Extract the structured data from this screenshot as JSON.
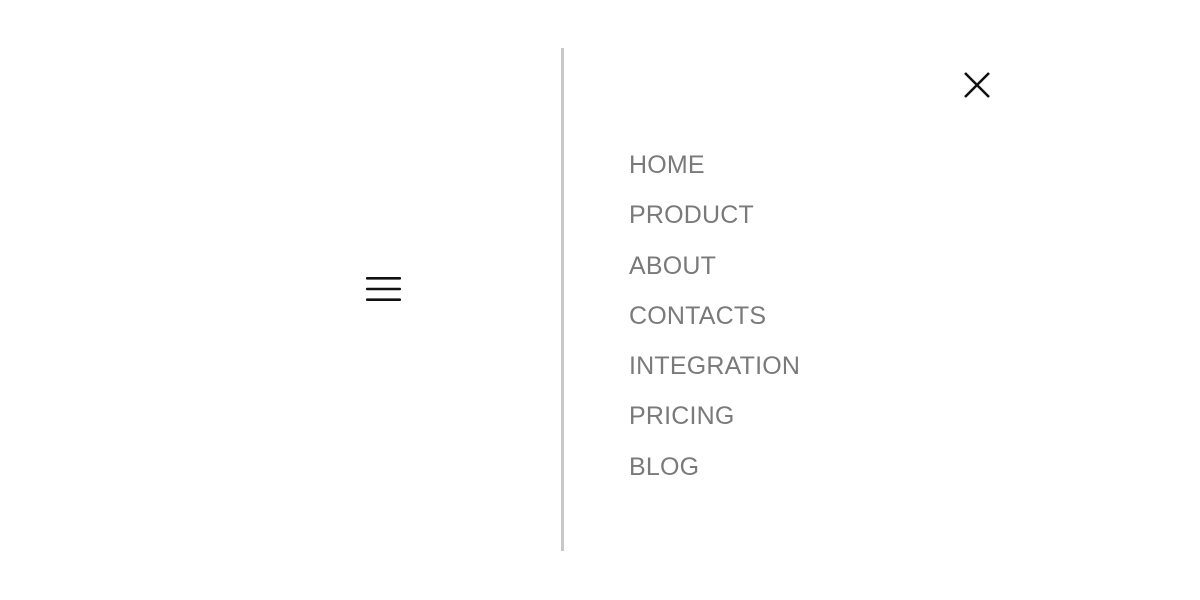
{
  "nav": {
    "open_icon": "hamburger-menu-icon",
    "close_icon": "close-icon",
    "items": [
      {
        "label": "HOME"
      },
      {
        "label": "PRODUCT"
      },
      {
        "label": "ABOUT"
      },
      {
        "label": "CONTACTS"
      },
      {
        "label": "INTEGRATION"
      },
      {
        "label": "PRICING"
      },
      {
        "label": "BLOG"
      }
    ]
  },
  "colors": {
    "background": "#ffffff",
    "icon": "#111111",
    "menu_text": "#7a7a7a",
    "divider": "#c8c8c8"
  }
}
